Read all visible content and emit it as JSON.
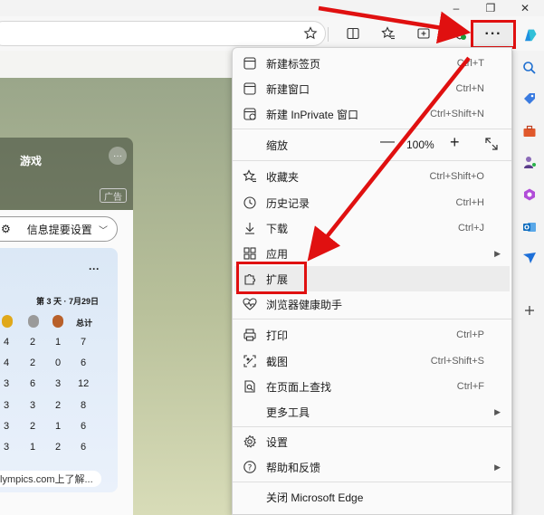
{
  "window": {
    "minimize": "–",
    "restore": "❐",
    "close": "✕"
  },
  "toolbar": {
    "more_label": "···"
  },
  "page": {
    "card_title": "游戏",
    "card_more": "···",
    "ad_label": "广告",
    "feed_pill": "信息提要设置",
    "medal_more": "···",
    "day_label": "第 3 天 · 7月29日",
    "total_label": "总计",
    "medal_rows": [
      [
        "4",
        "2",
        "1",
        "7"
      ],
      [
        "4",
        "2",
        "0",
        "6"
      ],
      [
        "3",
        "6",
        "3",
        "12"
      ],
      [
        "3",
        "3",
        "2",
        "8"
      ],
      [
        "3",
        "2",
        "1",
        "6"
      ],
      [
        "3",
        "1",
        "2",
        "6"
      ]
    ],
    "olympics_link": "lympics.com上了解..."
  },
  "menu": {
    "new_tab": {
      "label": "新建标签页",
      "shortcut": "Ctrl+T"
    },
    "new_window": {
      "label": "新建窗口",
      "shortcut": "Ctrl+N"
    },
    "new_inprivate": {
      "label": "新建 InPrivate 窗口",
      "shortcut": "Ctrl+Shift+N"
    },
    "zoom": {
      "label": "缩放",
      "minus": "—",
      "value": "100%",
      "plus": "+"
    },
    "favorites": {
      "label": "收藏夹",
      "shortcut": "Ctrl+Shift+O"
    },
    "history": {
      "label": "历史记录",
      "shortcut": "Ctrl+H"
    },
    "downloads": {
      "label": "下载",
      "shortcut": "Ctrl+J"
    },
    "apps": {
      "label": "应用"
    },
    "extensions": {
      "label": "扩展"
    },
    "browser_essentials": {
      "label": "浏览器健康助手"
    },
    "print": {
      "label": "打印",
      "shortcut": "Ctrl+P"
    },
    "screenshot": {
      "label": "截图",
      "shortcut": "Ctrl+Shift+S"
    },
    "find": {
      "label": "在页面上查找",
      "shortcut": "Ctrl+F"
    },
    "more_tools": {
      "label": "更多工具"
    },
    "settings": {
      "label": "设置"
    },
    "help": {
      "label": "帮助和反馈"
    },
    "close_edge": {
      "label": "关闭 Microsoft Edge"
    }
  },
  "colors": {
    "highlight": "#e01010"
  }
}
